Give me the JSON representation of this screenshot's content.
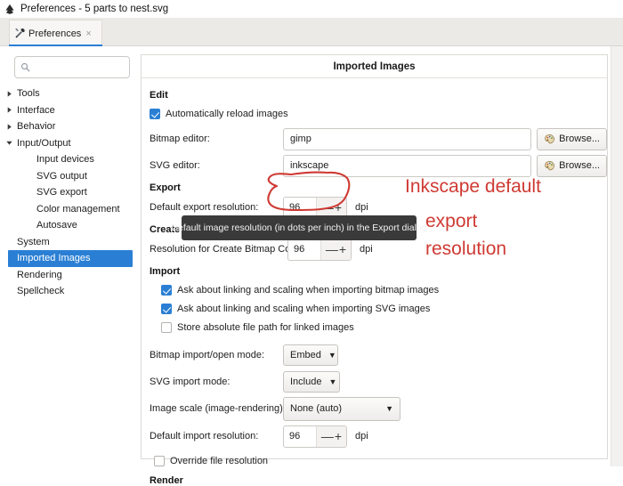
{
  "window": {
    "title": "Preferences - 5 parts to nest.svg",
    "app_icon": "inkscape-logo-icon"
  },
  "tab": {
    "label": "Preferences",
    "icon": "tools-icon",
    "close_icon": "×"
  },
  "sidebar": {
    "search": {
      "value": "",
      "placeholder": ""
    },
    "items": [
      {
        "label": "Tools",
        "level": 0,
        "expander": "collapsed",
        "selected": false
      },
      {
        "label": "Interface",
        "level": 0,
        "expander": "collapsed",
        "selected": false
      },
      {
        "label": "Behavior",
        "level": 0,
        "expander": "collapsed",
        "selected": false
      },
      {
        "label": "Input/Output",
        "level": 0,
        "expander": "expanded",
        "selected": false
      },
      {
        "label": "Input devices",
        "level": 1,
        "expander": "none",
        "selected": false
      },
      {
        "label": "SVG output",
        "level": 1,
        "expander": "none",
        "selected": false
      },
      {
        "label": "SVG export",
        "level": 1,
        "expander": "none",
        "selected": false
      },
      {
        "label": "Color management",
        "level": 1,
        "expander": "none",
        "selected": false
      },
      {
        "label": "Autosave",
        "level": 1,
        "expander": "none",
        "selected": false
      },
      {
        "label": "System",
        "level": 0,
        "expander": "none",
        "selected": false
      },
      {
        "label": "Imported Images",
        "level": 0,
        "expander": "none",
        "selected": true
      },
      {
        "label": "Rendering",
        "level": 0,
        "expander": "none",
        "selected": false
      },
      {
        "label": "Spellcheck",
        "level": 0,
        "expander": "none",
        "selected": false
      }
    ]
  },
  "panel": {
    "title": "Imported Images",
    "sections": {
      "edit": {
        "heading": "Edit",
        "auto_reload": {
          "label": "Automatically reload images",
          "checked": true
        },
        "bitmap_editor": {
          "label": "Bitmap editor:",
          "value": "gimp",
          "browse": "Browse..."
        },
        "svg_editor": {
          "label": "SVG editor:",
          "value": "inkscape",
          "browse": "Browse..."
        }
      },
      "export": {
        "heading": "Export",
        "default_export_resolution": {
          "label": "Default export resolution:",
          "value": "96",
          "unit": "dpi",
          "minus": "—",
          "plus": "+"
        }
      },
      "create": {
        "heading": "Create",
        "create_bitmap_resolution": {
          "label": "Resolution for Create Bitmap Copy:",
          "value": "96",
          "unit": "dpi",
          "minus": "—",
          "plus": "+"
        }
      },
      "import": {
        "heading": "Import",
        "checkboxes": [
          {
            "label": "Ask about linking and scaling when importing bitmap images",
            "checked": true
          },
          {
            "label": "Ask about linking and scaling when importing SVG images",
            "checked": true
          },
          {
            "label": "Store absolute file path for linked images",
            "checked": false
          }
        ],
        "bitmap_import_mode": {
          "label": "Bitmap import/open mode:",
          "value": "Embed"
        },
        "svg_import_mode": {
          "label": "SVG import mode:",
          "value": "Include"
        },
        "image_scale": {
          "label": "Image scale (image-rendering):",
          "value": "None (auto)"
        },
        "default_import_resolution": {
          "label": "Default import resolution:",
          "value": "96",
          "unit": "dpi",
          "minus": "—",
          "plus": "+"
        },
        "override_file_resolution": {
          "label": "Override file resolution",
          "checked": false
        }
      },
      "render": {
        "heading": "Render"
      }
    }
  },
  "tooltip": {
    "text": "Default image resolution (in dots per inch) in the Export dialog"
  },
  "annotation": {
    "color": "#cf3a33",
    "lines": [
      "Inkscape default",
      "export",
      "resolution"
    ]
  },
  "colors": {
    "selection_blue": "#2a7fd4",
    "annotation_red": "#cf3a33",
    "tooltip_bg": "#3a3a3a"
  }
}
